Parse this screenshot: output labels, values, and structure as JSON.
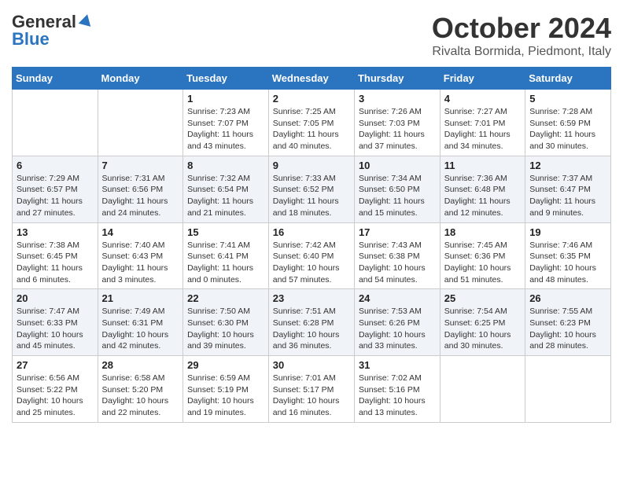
{
  "header": {
    "logo_general": "General",
    "logo_blue": "Blue",
    "month_title": "October 2024",
    "location": "Rivalta Bormida, Piedmont, Italy"
  },
  "days_of_week": [
    "Sunday",
    "Monday",
    "Tuesday",
    "Wednesday",
    "Thursday",
    "Friday",
    "Saturday"
  ],
  "weeks": [
    [
      {
        "day": "",
        "content": ""
      },
      {
        "day": "",
        "content": ""
      },
      {
        "day": "1",
        "content": "Sunrise: 7:23 AM\nSunset: 7:07 PM\nDaylight: 11 hours and 43 minutes."
      },
      {
        "day": "2",
        "content": "Sunrise: 7:25 AM\nSunset: 7:05 PM\nDaylight: 11 hours and 40 minutes."
      },
      {
        "day": "3",
        "content": "Sunrise: 7:26 AM\nSunset: 7:03 PM\nDaylight: 11 hours and 37 minutes."
      },
      {
        "day": "4",
        "content": "Sunrise: 7:27 AM\nSunset: 7:01 PM\nDaylight: 11 hours and 34 minutes."
      },
      {
        "day": "5",
        "content": "Sunrise: 7:28 AM\nSunset: 6:59 PM\nDaylight: 11 hours and 30 minutes."
      }
    ],
    [
      {
        "day": "6",
        "content": "Sunrise: 7:29 AM\nSunset: 6:57 PM\nDaylight: 11 hours and 27 minutes."
      },
      {
        "day": "7",
        "content": "Sunrise: 7:31 AM\nSunset: 6:56 PM\nDaylight: 11 hours and 24 minutes."
      },
      {
        "day": "8",
        "content": "Sunrise: 7:32 AM\nSunset: 6:54 PM\nDaylight: 11 hours and 21 minutes."
      },
      {
        "day": "9",
        "content": "Sunrise: 7:33 AM\nSunset: 6:52 PM\nDaylight: 11 hours and 18 minutes."
      },
      {
        "day": "10",
        "content": "Sunrise: 7:34 AM\nSunset: 6:50 PM\nDaylight: 11 hours and 15 minutes."
      },
      {
        "day": "11",
        "content": "Sunrise: 7:36 AM\nSunset: 6:48 PM\nDaylight: 11 hours and 12 minutes."
      },
      {
        "day": "12",
        "content": "Sunrise: 7:37 AM\nSunset: 6:47 PM\nDaylight: 11 hours and 9 minutes."
      }
    ],
    [
      {
        "day": "13",
        "content": "Sunrise: 7:38 AM\nSunset: 6:45 PM\nDaylight: 11 hours and 6 minutes."
      },
      {
        "day": "14",
        "content": "Sunrise: 7:40 AM\nSunset: 6:43 PM\nDaylight: 11 hours and 3 minutes."
      },
      {
        "day": "15",
        "content": "Sunrise: 7:41 AM\nSunset: 6:41 PM\nDaylight: 11 hours and 0 minutes."
      },
      {
        "day": "16",
        "content": "Sunrise: 7:42 AM\nSunset: 6:40 PM\nDaylight: 10 hours and 57 minutes."
      },
      {
        "day": "17",
        "content": "Sunrise: 7:43 AM\nSunset: 6:38 PM\nDaylight: 10 hours and 54 minutes."
      },
      {
        "day": "18",
        "content": "Sunrise: 7:45 AM\nSunset: 6:36 PM\nDaylight: 10 hours and 51 minutes."
      },
      {
        "day": "19",
        "content": "Sunrise: 7:46 AM\nSunset: 6:35 PM\nDaylight: 10 hours and 48 minutes."
      }
    ],
    [
      {
        "day": "20",
        "content": "Sunrise: 7:47 AM\nSunset: 6:33 PM\nDaylight: 10 hours and 45 minutes."
      },
      {
        "day": "21",
        "content": "Sunrise: 7:49 AM\nSunset: 6:31 PM\nDaylight: 10 hours and 42 minutes."
      },
      {
        "day": "22",
        "content": "Sunrise: 7:50 AM\nSunset: 6:30 PM\nDaylight: 10 hours and 39 minutes."
      },
      {
        "day": "23",
        "content": "Sunrise: 7:51 AM\nSunset: 6:28 PM\nDaylight: 10 hours and 36 minutes."
      },
      {
        "day": "24",
        "content": "Sunrise: 7:53 AM\nSunset: 6:26 PM\nDaylight: 10 hours and 33 minutes."
      },
      {
        "day": "25",
        "content": "Sunrise: 7:54 AM\nSunset: 6:25 PM\nDaylight: 10 hours and 30 minutes."
      },
      {
        "day": "26",
        "content": "Sunrise: 7:55 AM\nSunset: 6:23 PM\nDaylight: 10 hours and 28 minutes."
      }
    ],
    [
      {
        "day": "27",
        "content": "Sunrise: 6:56 AM\nSunset: 5:22 PM\nDaylight: 10 hours and 25 minutes."
      },
      {
        "day": "28",
        "content": "Sunrise: 6:58 AM\nSunset: 5:20 PM\nDaylight: 10 hours and 22 minutes."
      },
      {
        "day": "29",
        "content": "Sunrise: 6:59 AM\nSunset: 5:19 PM\nDaylight: 10 hours and 19 minutes."
      },
      {
        "day": "30",
        "content": "Sunrise: 7:01 AM\nSunset: 5:17 PM\nDaylight: 10 hours and 16 minutes."
      },
      {
        "day": "31",
        "content": "Sunrise: 7:02 AM\nSunset: 5:16 PM\nDaylight: 10 hours and 13 minutes."
      },
      {
        "day": "",
        "content": ""
      },
      {
        "day": "",
        "content": ""
      }
    ]
  ]
}
